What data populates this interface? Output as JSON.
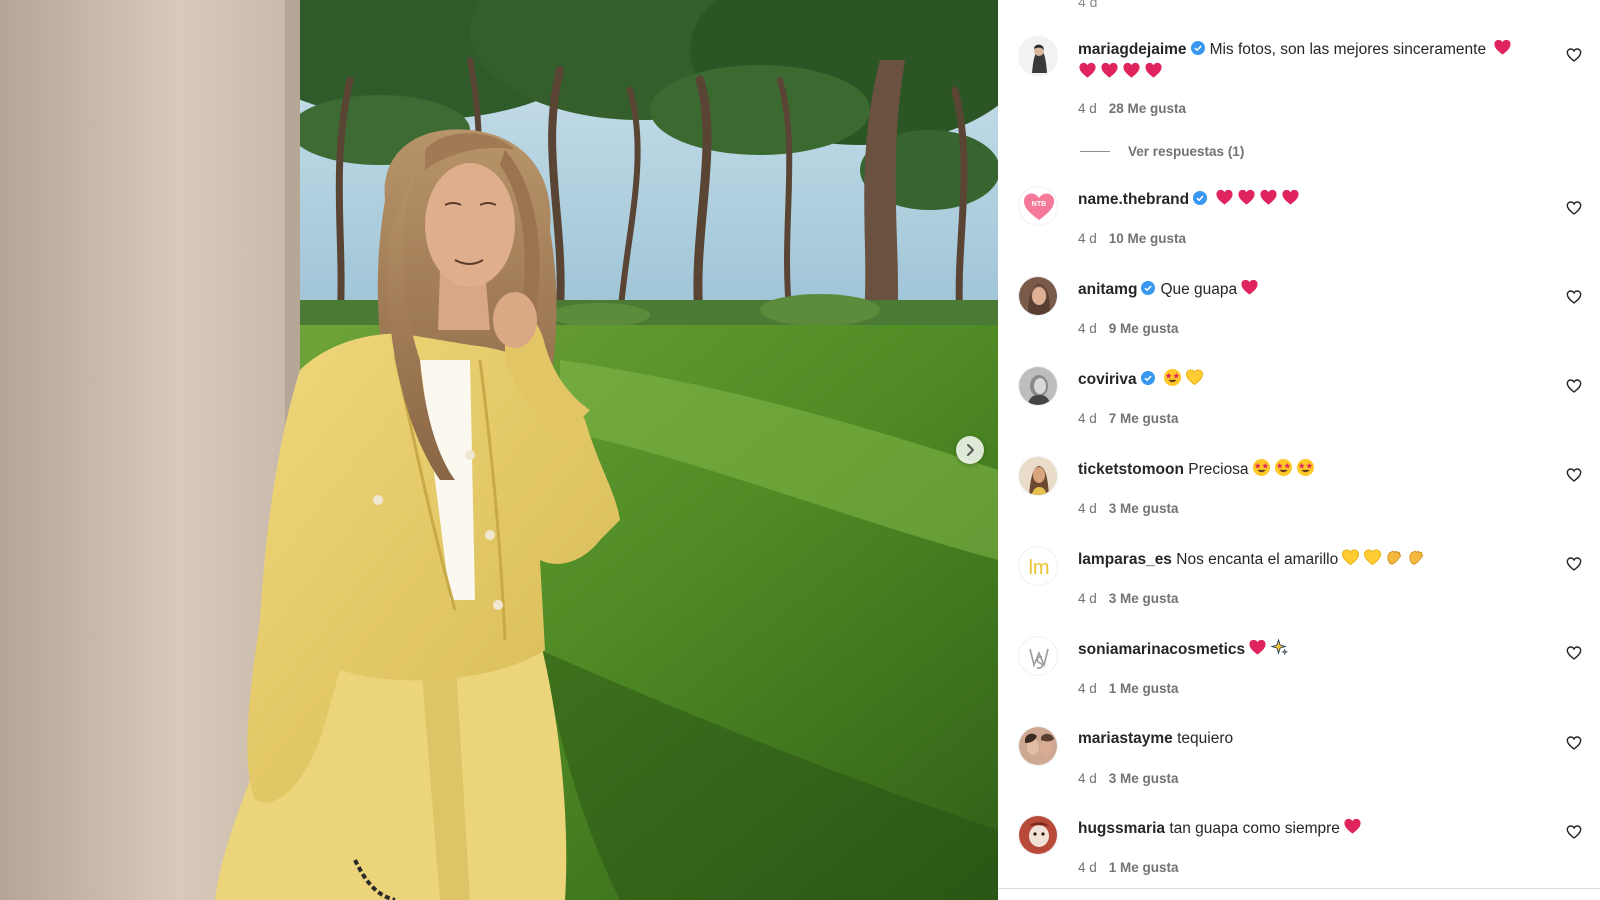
{
  "header": {
    "timestamp_fragment": "4 d"
  },
  "media": {
    "next_icon": "chevron-right-icon",
    "description_icon": "photo"
  },
  "colors": {
    "verified": "#3897f0",
    "heart_emoji": "#e0245e",
    "muted_text": "#737373"
  },
  "comments": [
    {
      "username": "mariagdejaime",
      "verified": true,
      "text": "Mis fotos, son las mejores sinceramente",
      "emojis": [
        "red-heart",
        "red-heart",
        "red-heart",
        "red-heart",
        "red-heart"
      ],
      "age": "4 d",
      "likes": "28 Me gusta",
      "replies_label": "Ver respuestas (1)"
    },
    {
      "username": "name.thebrand",
      "verified": true,
      "text": "",
      "emojis": [
        "red-heart",
        "red-heart",
        "red-heart",
        "red-heart"
      ],
      "age": "4 d",
      "likes": "10 Me gusta"
    },
    {
      "username": "anitamg",
      "verified": true,
      "text": "Que guapa",
      "emojis": [
        "red-heart"
      ],
      "age": "4 d",
      "likes": "9 Me gusta"
    },
    {
      "username": "coviriva",
      "verified": true,
      "text": "",
      "emojis": [
        "star-struck",
        "yellow-heart"
      ],
      "age": "4 d",
      "likes": "7 Me gusta"
    },
    {
      "username": "ticketstomoon",
      "verified": false,
      "text": "Preciosa",
      "emojis": [
        "star-struck",
        "star-struck",
        "star-struck"
      ],
      "age": "4 d",
      "likes": "3 Me gusta"
    },
    {
      "username": "lamparas_es",
      "verified": false,
      "text": "Nos encanta el amarillo",
      "emojis": [
        "yellow-heart",
        "yellow-heart",
        "clap",
        "clap"
      ],
      "age": "4 d",
      "likes": "3 Me gusta",
      "avatar_text": "lm"
    },
    {
      "username": "soniamarinacosmetics",
      "verified": false,
      "text": "",
      "emojis": [
        "red-heart",
        "sparkles"
      ],
      "age": "4 d",
      "likes": "1 Me gusta"
    },
    {
      "username": "mariastayme",
      "verified": false,
      "text": "tequiero",
      "emojis": [],
      "age": "4 d",
      "likes": "3 Me gusta"
    },
    {
      "username": "hugssmaria",
      "verified": false,
      "text": "tan guapa como siempre",
      "emojis": [
        "red-heart"
      ],
      "age": "4 d",
      "likes": "1 Me gusta"
    }
  ]
}
